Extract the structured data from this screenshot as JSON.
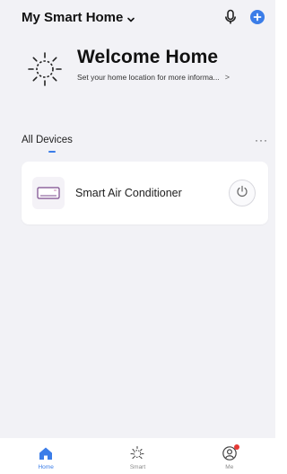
{
  "header": {
    "home_name": "My Smart Home",
    "chevron_icon": "chevron-down-icon",
    "mic_icon": "microphone-icon",
    "add_icon": "plus-circle-icon"
  },
  "welcome": {
    "icon": "sun-icon",
    "title": "Welcome Home",
    "subtitle": "Set your home location for more informa...",
    "arrow": ">"
  },
  "devices_section": {
    "title": "All Devices",
    "more": "···"
  },
  "devices": [
    {
      "name": "Smart Air Conditioner",
      "icon": "air-conditioner-icon",
      "power_icon": "power-icon"
    }
  ],
  "tabbar": {
    "tabs": [
      {
        "label": "Home",
        "icon": "home-icon",
        "active": true
      },
      {
        "label": "Smart",
        "icon": "sun-icon",
        "active": false
      },
      {
        "label": "Me",
        "icon": "user-circle-icon",
        "active": false,
        "badge": true
      }
    ]
  },
  "colors": {
    "accent": "#3b7de8",
    "background": "#f2f2f6",
    "card": "#ffffff",
    "badge": "#e53935"
  }
}
